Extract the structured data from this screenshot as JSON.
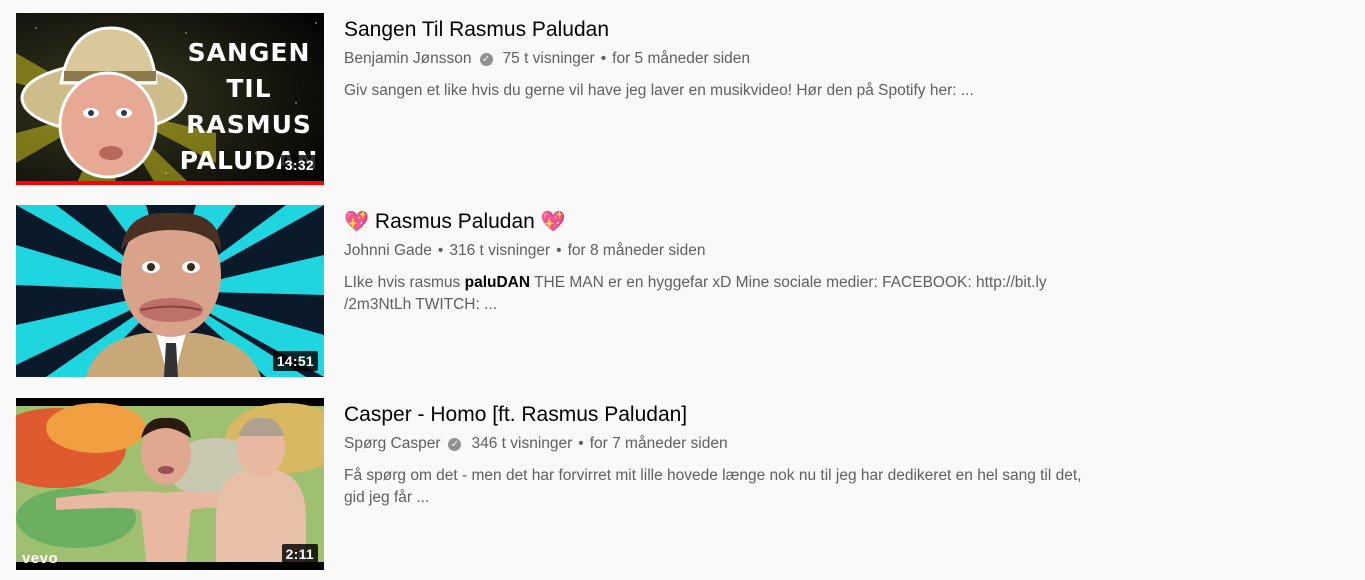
{
  "results": [
    {
      "title": "Sangen Til Rasmus Paludan",
      "channel": "Benjamin Jønsson",
      "verified": true,
      "views": "75 t visninger",
      "age": "for 5 måneder siden",
      "description": "Giv sangen et like hvis du gerne vil have jeg laver en musikvideo! Hør den på Spotify her: ...",
      "duration": "3:32",
      "thumb_text": [
        "SANGEN",
        "TIL",
        "RASMUS",
        "PALUDAN"
      ]
    },
    {
      "title": "Rasmus Paludan",
      "title_emoji": "💖",
      "channel": "Johnni Gade",
      "verified": false,
      "views": "316 t visninger",
      "age": "for 8 måneder siden",
      "description_pre": "LIke hvis rasmus ",
      "description_bold": "paluDAN",
      "description_post": " THE MAN er en hyggefar xD Mine sociale medier: FACEBOOK: http://bit.ly /2m3NtLh TWITCH: ...",
      "duration": "14:51"
    },
    {
      "title": "Casper - Homo [ft. Rasmus Paludan]",
      "channel": "Spørg Casper",
      "verified": true,
      "views": "346 t visninger",
      "age": "for 7 måneder siden",
      "description": "Få spørg om det - men det har forvirret mit lille hovede længe nok nu til jeg har dedikeret en hel sang til det, gid jeg får ...",
      "duration": "2:11",
      "badge": "vevo"
    }
  ],
  "separator": "•",
  "verified_glyph": "✓",
  "colors": {
    "progress": "#ff0000",
    "meta_text": "#606060",
    "title_text": "#030303"
  }
}
